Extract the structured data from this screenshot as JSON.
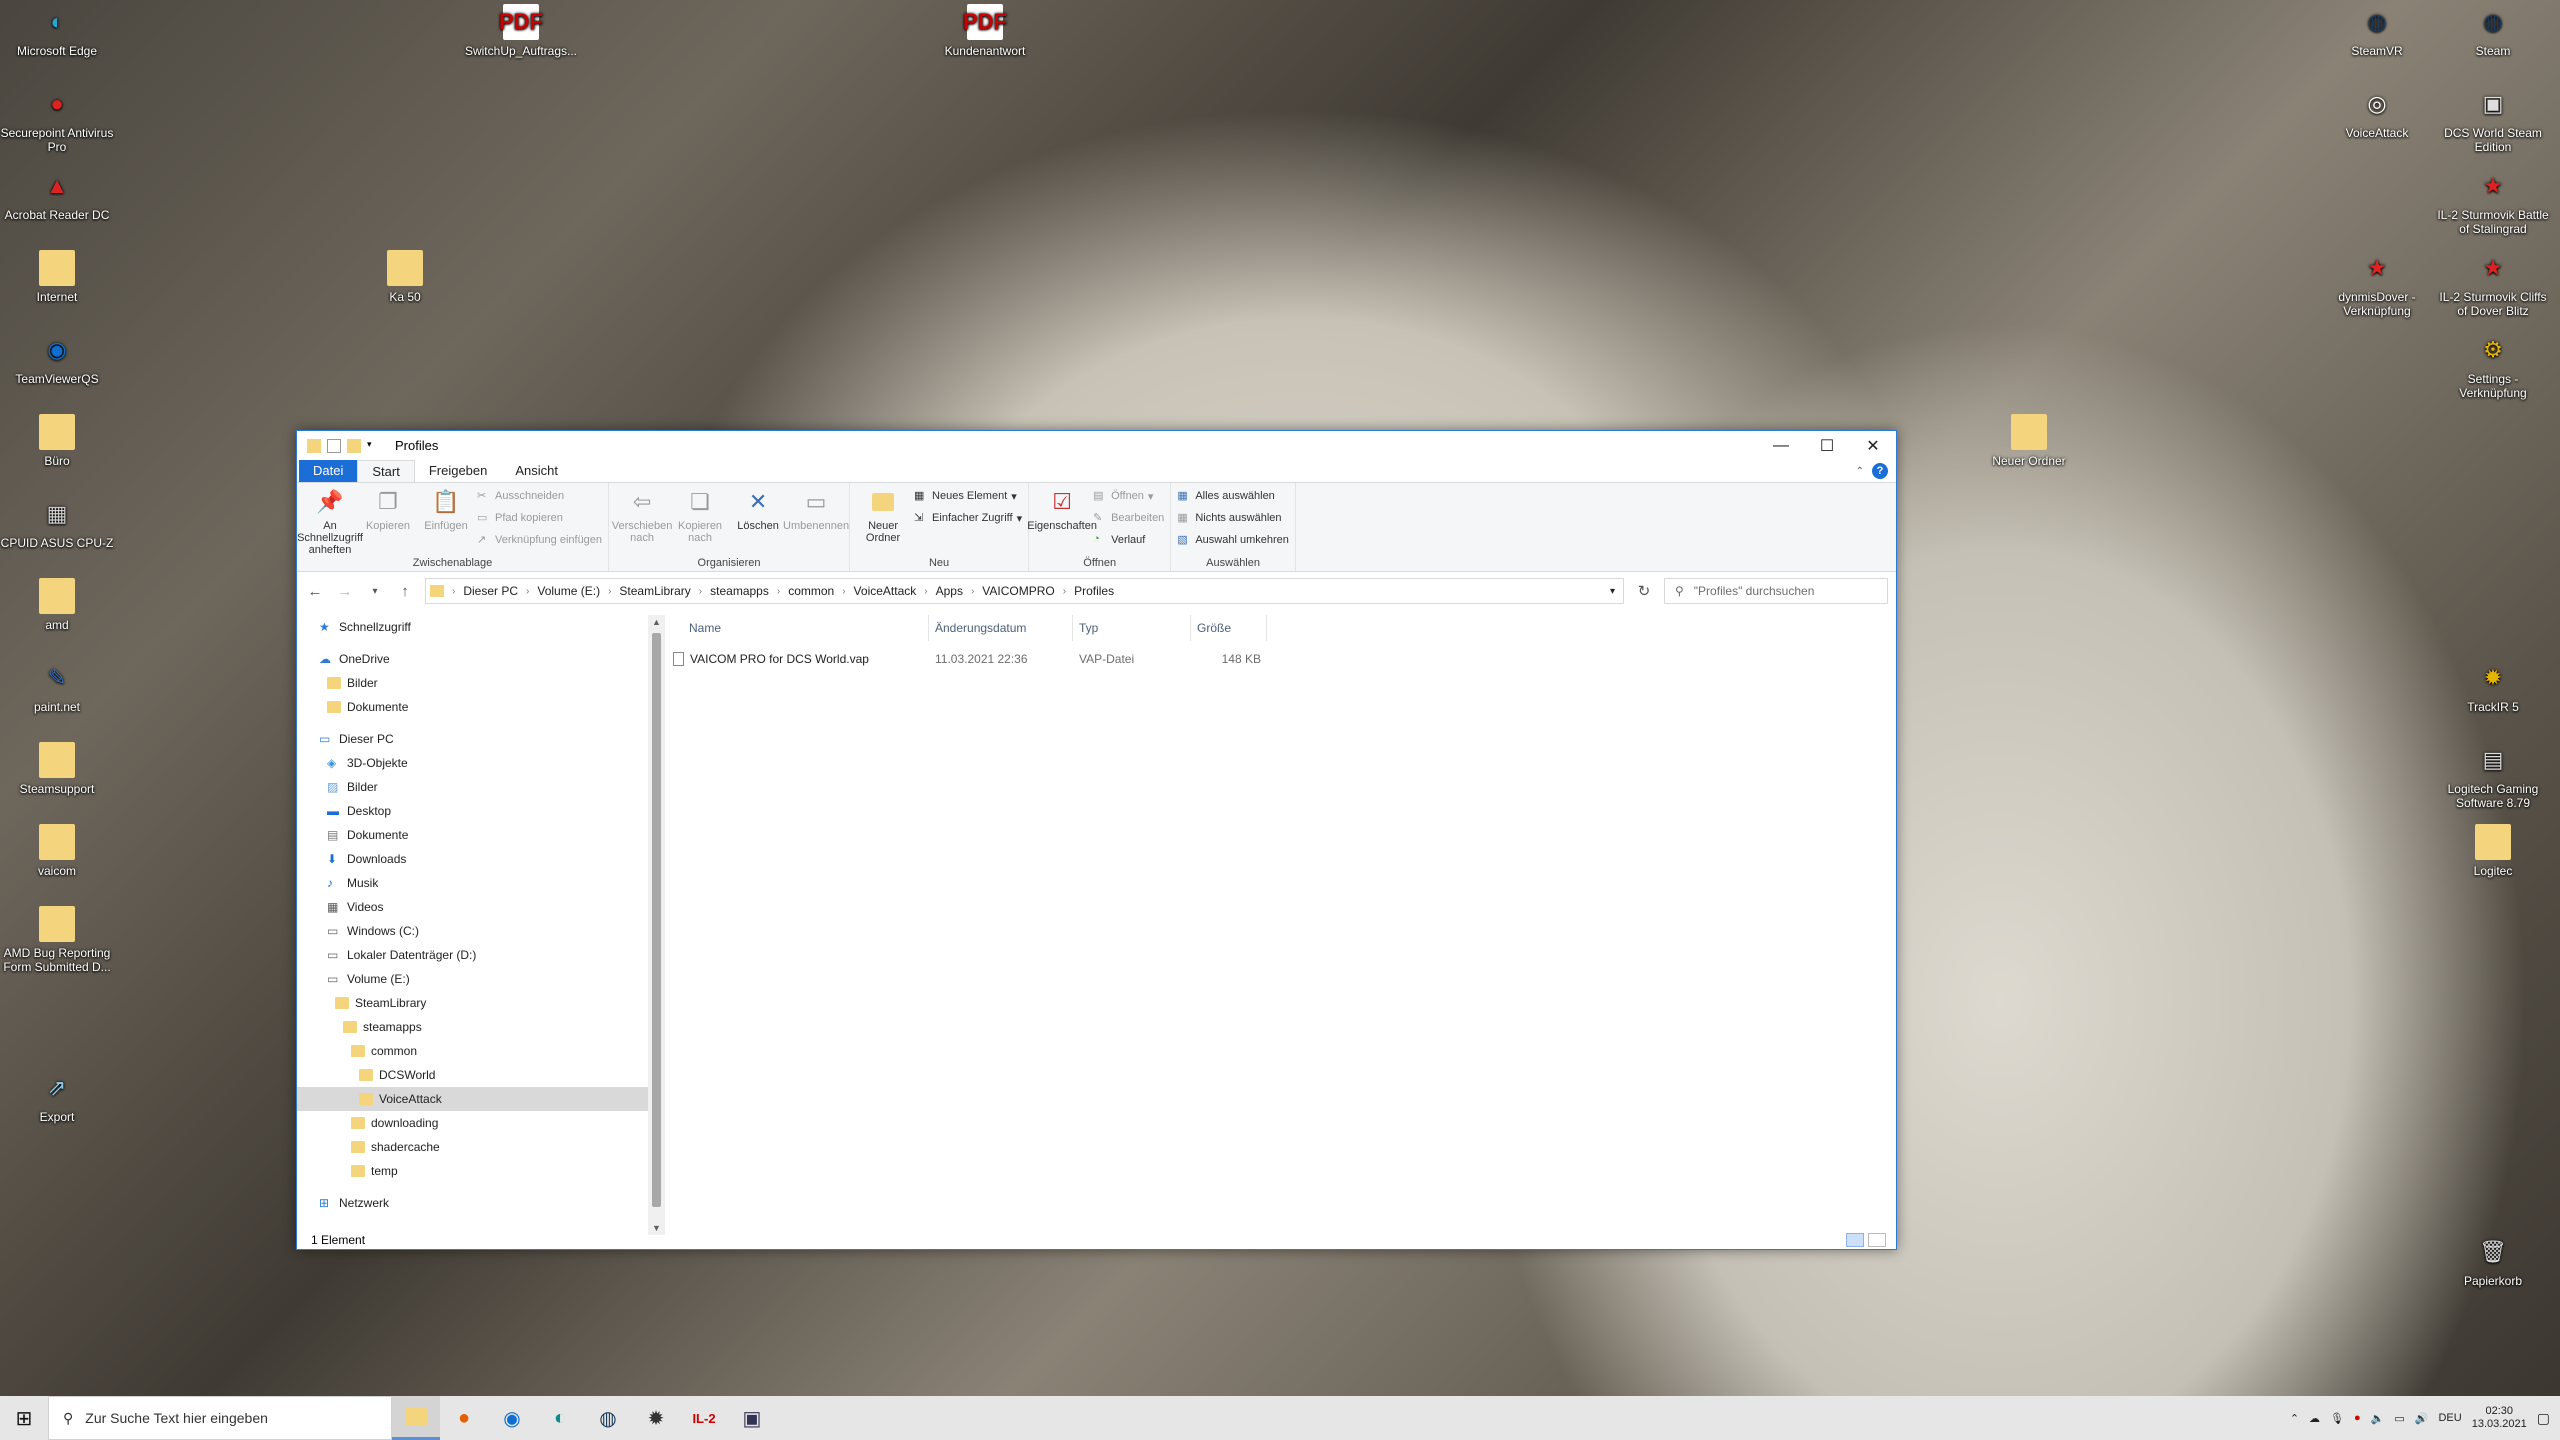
{
  "desktop": {
    "icons_left": [
      {
        "label": "Microsoft Edge",
        "icon": "edge-icon"
      },
      {
        "label": "Securepoint Antivirus Pro",
        "icon": "securepoint-icon"
      },
      {
        "label": "Acrobat Reader DC",
        "icon": "acrobat-icon"
      },
      {
        "label": "Internet",
        "icon": "folder-icon"
      },
      {
        "label": "TeamViewerQS",
        "icon": "teamviewer-icon"
      },
      {
        "label": "Büro",
        "icon": "folder-icon"
      },
      {
        "label": "CPUID ASUS CPU-Z",
        "icon": "cpuz-icon"
      },
      {
        "label": "amd",
        "icon": "folder-icon"
      },
      {
        "label": "paint.net",
        "icon": "paintnet-icon"
      },
      {
        "label": "Steamsupport",
        "icon": "folder-icon"
      },
      {
        "label": "vaicom",
        "icon": "folder-icon"
      },
      {
        "label": "AMD Bug Reporting Form Submitted D...",
        "icon": "folder-icon"
      },
      {
        "label": "Export",
        "icon": "export-icon"
      }
    ],
    "icons_top": [
      {
        "label": "SwitchUp_Auftrags...",
        "icon": "pdf-icon"
      },
      {
        "label": "Kundenantwort",
        "icon": "pdf-icon"
      },
      {
        "label": "Ka 50",
        "icon": "folder-icon"
      }
    ],
    "icons_right": [
      {
        "label": "SteamVR",
        "icon": "steamvr-icon"
      },
      {
        "label": "Steam",
        "icon": "steam-icon"
      },
      {
        "label": "VoiceAttack",
        "icon": "voiceattack-icon"
      },
      {
        "label": "DCS World Steam Edition",
        "icon": "dcs-icon"
      },
      {
        "label": "IL-2 Sturmovik Battle of Stalingrad",
        "icon": "il2-icon"
      },
      {
        "label": "dynmisDover - Verknüpfung",
        "icon": "il2-icon"
      },
      {
        "label": "IL-2 Sturmovik Cliffs of Dover Blitz",
        "icon": "il2-icon"
      },
      {
        "label": "Settings - Verknüpfung",
        "icon": "settings-icon"
      },
      {
        "label": "Neuer Ordner",
        "icon": "folder-icon"
      },
      {
        "label": "TrackIR 5",
        "icon": "trackir-icon"
      },
      {
        "label": "Logitech Gaming Software 8.79",
        "icon": "logitech-icon"
      },
      {
        "label": "Logitec",
        "icon": "folder-icon"
      },
      {
        "label": "Papierkorb",
        "icon": "recycle-bin-icon"
      }
    ]
  },
  "window": {
    "title": "Profiles",
    "tabs": [
      "Datei",
      "Start",
      "Freigeben",
      "Ansicht"
    ],
    "ribbon": {
      "clipboard": {
        "pin": "An Schnellzugriff anheften",
        "copy": "Kopieren",
        "paste": "Einfügen",
        "cut": "Ausschneiden",
        "copy_path": "Pfad kopieren",
        "paste_shortcut": "Verknüpfung einfügen",
        "group": "Zwischenablage"
      },
      "organize": {
        "move": "Verschieben nach",
        "copy_to": "Kopieren nach",
        "delete": "Löschen",
        "rename": "Umbenennen",
        "group": "Organisieren"
      },
      "new": {
        "new_folder": "Neuer Ordner",
        "new_item": "Neues Element",
        "easy_access": "Einfacher Zugriff",
        "group": "Neu"
      },
      "open": {
        "properties": "Eigenschaften",
        "open": "Öffnen",
        "edit": "Bearbeiten",
        "history": "Verlauf",
        "group": "Öffnen"
      },
      "select": {
        "all": "Alles auswählen",
        "none": "Nichts auswählen",
        "invert": "Auswahl umkehren",
        "group": "Auswählen"
      }
    },
    "breadcrumb": [
      "Dieser PC",
      "Volume (E:)",
      "SteamLibrary",
      "steamapps",
      "common",
      "VoiceAttack",
      "Apps",
      "VAICOMPRO",
      "Profiles"
    ],
    "search_placeholder": "\"Profiles\" durchsuchen",
    "tree": [
      {
        "label": "Schnellzugriff",
        "indent": 0,
        "icon": "star-icon"
      },
      {
        "label": "OneDrive",
        "indent": 0,
        "icon": "cloud-icon"
      },
      {
        "label": "Bilder",
        "indent": 1,
        "icon": "folder-icon"
      },
      {
        "label": "Dokumente",
        "indent": 1,
        "icon": "folder-icon"
      },
      {
        "label": "Dieser PC",
        "indent": 0,
        "icon": "pc-icon"
      },
      {
        "label": "3D-Objekte",
        "indent": 1,
        "icon": "cube-icon"
      },
      {
        "label": "Bilder",
        "indent": 1,
        "icon": "pictures-icon"
      },
      {
        "label": "Desktop",
        "indent": 1,
        "icon": "desktop-icon"
      },
      {
        "label": "Dokumente",
        "indent": 1,
        "icon": "documents-icon"
      },
      {
        "label": "Downloads",
        "indent": 1,
        "icon": "download-icon"
      },
      {
        "label": "Musik",
        "indent": 1,
        "icon": "music-icon"
      },
      {
        "label": "Videos",
        "indent": 1,
        "icon": "video-icon"
      },
      {
        "label": "Windows (C:)",
        "indent": 1,
        "icon": "drive-icon"
      },
      {
        "label": "Lokaler Datenträger (D:)",
        "indent": 1,
        "icon": "drive-icon"
      },
      {
        "label": "Volume (E:)",
        "indent": 1,
        "icon": "drive-icon"
      },
      {
        "label": "SteamLibrary",
        "indent": 2,
        "icon": "folder-icon"
      },
      {
        "label": "steamapps",
        "indent": 3,
        "icon": "folder-icon"
      },
      {
        "label": "common",
        "indent": 4,
        "icon": "folder-icon"
      },
      {
        "label": "DCSWorld",
        "indent": 5,
        "icon": "folder-icon"
      },
      {
        "label": "VoiceAttack",
        "indent": 5,
        "icon": "folder-icon",
        "selected": true
      },
      {
        "label": "downloading",
        "indent": 4,
        "icon": "folder-icon"
      },
      {
        "label": "shadercache",
        "indent": 4,
        "icon": "folder-icon"
      },
      {
        "label": "temp",
        "indent": 4,
        "icon": "folder-icon"
      },
      {
        "label": "Netzwerk",
        "indent": 0,
        "icon": "network-icon"
      }
    ],
    "columns": [
      "Name",
      "Änderungsdatum",
      "Typ",
      "Größe"
    ],
    "files": [
      {
        "name": "VAICOM PRO for DCS World.vap",
        "date": "11.03.2021 22:36",
        "type": "VAP-Datei",
        "size": "148 KB"
      }
    ],
    "status": "1 Element"
  },
  "taskbar": {
    "search_placeholder": "Zur Suche Text hier eingeben",
    "language": "DEU",
    "time": "02:30",
    "date": "13.03.2021"
  }
}
